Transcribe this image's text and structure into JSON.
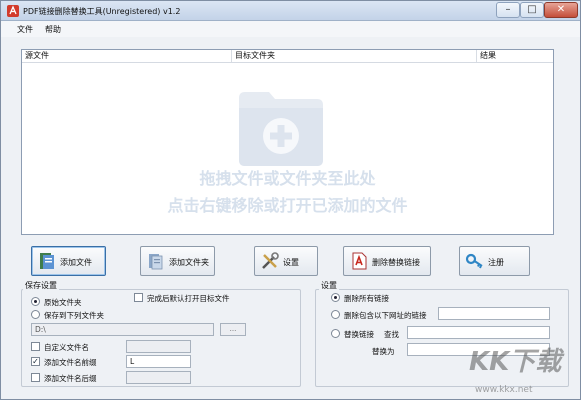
{
  "window": {
    "title": "PDF链接删除替换工具(Unregistered) v1.2",
    "controls": {
      "minimize": "–",
      "maximize": "□",
      "close": "✕"
    }
  },
  "menu": {
    "file": "文件",
    "help": "帮助"
  },
  "file_list": {
    "columns": [
      "源文件",
      "目标文件夹",
      "结果"
    ],
    "rows": [],
    "hint_line1": "拖拽文件或文件夹至此处",
    "hint_line2": "点击右键移除或打开已添加的文件",
    "icon": "folder-add-icon"
  },
  "toolbar": {
    "add_file": "添加文件",
    "add_folder": "添加文件夹",
    "settings": "设置",
    "delete_replace": "删除替换链接",
    "register": "注册"
  },
  "save_settings": {
    "title": "保存设置",
    "radio_original": "原始文件夹",
    "radio_folder": "保存到下列文件夹",
    "radio_selected": "original",
    "open_after": "完成后默认打开目标文件",
    "open_after_checked": false,
    "path_value": "D:\\",
    "browse_label": "...",
    "custom_name": "自定义文件名",
    "custom_name_checked": false,
    "prefix": "添加文件名前缀",
    "prefix_checked": true,
    "prefix_value": "L",
    "suffix": "添加文件名后缀",
    "suffix_checked": false
  },
  "link_settings": {
    "title": "设置",
    "delete_all": "删除所有链接",
    "delete_containing": "删除包含以下网址的链接",
    "replace": "替换链接",
    "find_label": "查找",
    "replace_with_label": "替换为",
    "selected": "delete_all"
  },
  "watermark": {
    "logo": "KK下载",
    "url": "www.kkx.net"
  },
  "colors": {
    "accent": "#3a6fa6",
    "hint_text": "#d6e0ec",
    "window_bg": "#eef1f5"
  }
}
